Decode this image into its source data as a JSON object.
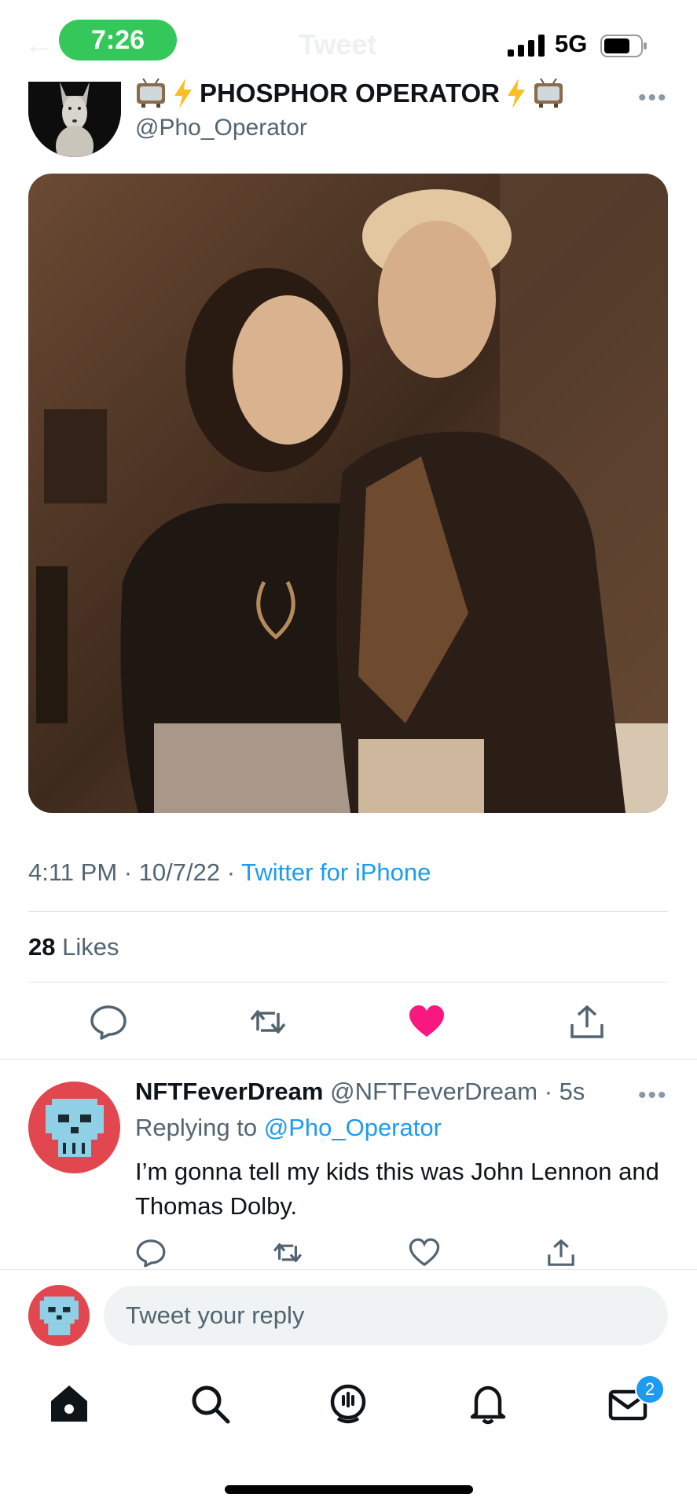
{
  "status_bar": {
    "time": "7:26",
    "network": "5G"
  },
  "nav": {
    "title": "Tweet"
  },
  "tweet": {
    "display_name": "PHOSPHOR OPERATOR",
    "handle": "@Pho_Operator",
    "name_emojis": [
      "tv-icon",
      "lightning-icon",
      "lightning-icon",
      "tv-icon"
    ],
    "timestamp": "4:11 PM · 10/7/22 · ",
    "source": "Twitter for iPhone",
    "likes_count": "28",
    "likes_label": " Likes",
    "liked": true
  },
  "reply": {
    "display_name": "NFTFeverDream",
    "handle_time": " @NFTFeverDream · 5s",
    "replying_prefix": "Replying to ",
    "replying_to": "@Pho_Operator",
    "text": "I’m gonna tell my kids this was John Lennon and Thomas Dolby."
  },
  "composer": {
    "placeholder": "Tweet your reply"
  },
  "tab_bar": {
    "messages_badge": "2"
  },
  "colors": {
    "accent": "#1d9bf0",
    "like": "#f91880",
    "status_pill": "#34c759",
    "reply_avatar": "#e2464e"
  }
}
